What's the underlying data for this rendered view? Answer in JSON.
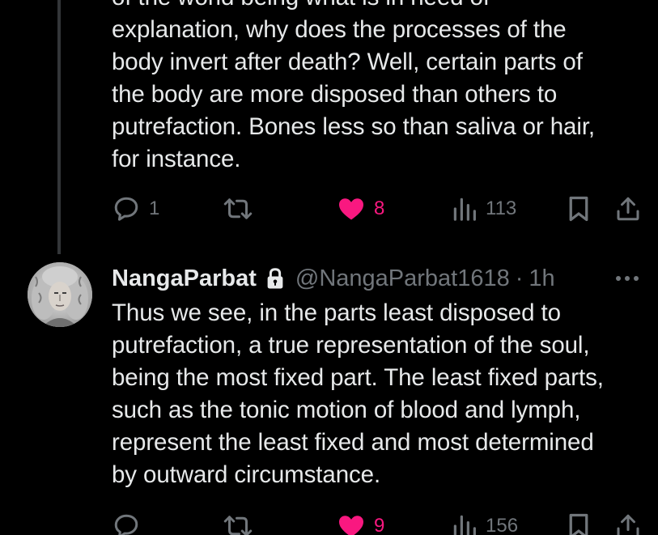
{
  "tweet1": {
    "text": "of the world being what is in need of\nexplanation, why does the processes of the\nbody invert after death? Well, certain parts of\nthe body are more disposed than others to\nputrefaction. Bones less so than saliva or hair,\nfor instance.",
    "replies": "1",
    "likes": "8",
    "views": "113",
    "liked": true
  },
  "tweet2": {
    "display_name": "NangaParbat",
    "handle": "@NangaParbat1618",
    "separator": "·",
    "time": "1h",
    "protected": true,
    "text": "Thus we see, in the parts least disposed to\nputrefaction, a true representation of the soul,\nbeing the most fixed part. The least fixed parts,\nsuch as the tonic motion of blood and lymph,\nrepresent the least fixed and most determined\nby outward circumstance.",
    "likes": "9",
    "views": "156",
    "liked": true
  },
  "colors": {
    "background": "#000000",
    "text": "#e7e9ea",
    "muted": "#71767b",
    "like": "#f91880",
    "thread_line": "#333639"
  },
  "icons": [
    "reply-icon",
    "retweet-icon",
    "heart-icon",
    "views-icon",
    "bookmark-icon",
    "share-icon",
    "lock-icon",
    "more-icon"
  ]
}
